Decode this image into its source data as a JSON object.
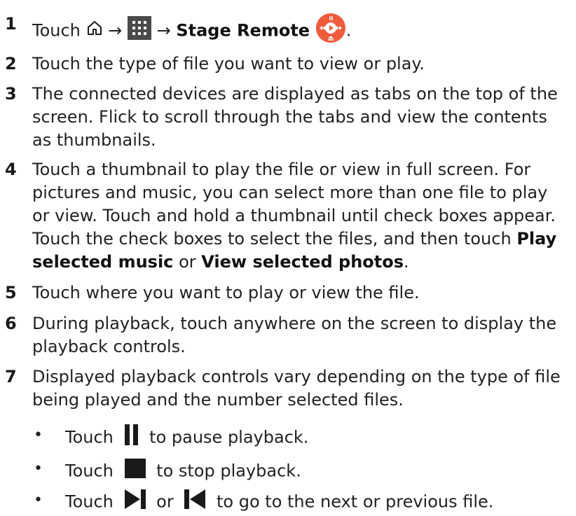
{
  "steps": [
    {
      "number": "1",
      "parts": {
        "touch": "Touch",
        "arrow1": "→",
        "arrow2": "→",
        "app_name": "Stage Remote",
        "end": "."
      },
      "icons": [
        "home-icon",
        "apps-grid-icon",
        "stage-remote-app-icon"
      ]
    },
    {
      "number": "2",
      "text": "Touch the type of file you want to view or play."
    },
    {
      "number": "3",
      "text": "The connected devices are displayed as tabs on the top of the screen. Flick to scroll through the tabs and view the contents as thumbnails."
    },
    {
      "number": "4",
      "text_before": "Touch a thumbnail to play the file or view in full screen. For pictures and music, you can select more than one file to play or view. Touch and hold a thumbnail until check boxes appear. Touch the check boxes to select the files, and then touch",
      "bold1": "Play selected music",
      "mid": "or",
      "bold2": "View selected photos",
      "end": "."
    },
    {
      "number": "5",
      "text": "Touch where you want to play or view the file."
    },
    {
      "number": "6",
      "text": "During playback, touch anywhere on the screen to display the playback controls."
    },
    {
      "number": "7",
      "text": "Displayed playback controls vary depending on the type of file being played and the number selected files."
    }
  ],
  "bullets": [
    {
      "dot": "•",
      "before": "Touch",
      "after": "to pause playback.",
      "icon": "pause-icon"
    },
    {
      "dot": "•",
      "before": "Touch",
      "after": "to stop playback.",
      "icon": "stop-icon"
    },
    {
      "dot": "•",
      "before": "Touch",
      "mid": "or",
      "after": "to go to the next or previous file.",
      "icons": [
        "next-icon",
        "previous-icon"
      ]
    }
  ],
  "colors": {
    "text": "#222222",
    "app_icon": "#f15a3a",
    "control_icon": "#1a1a1a"
  }
}
